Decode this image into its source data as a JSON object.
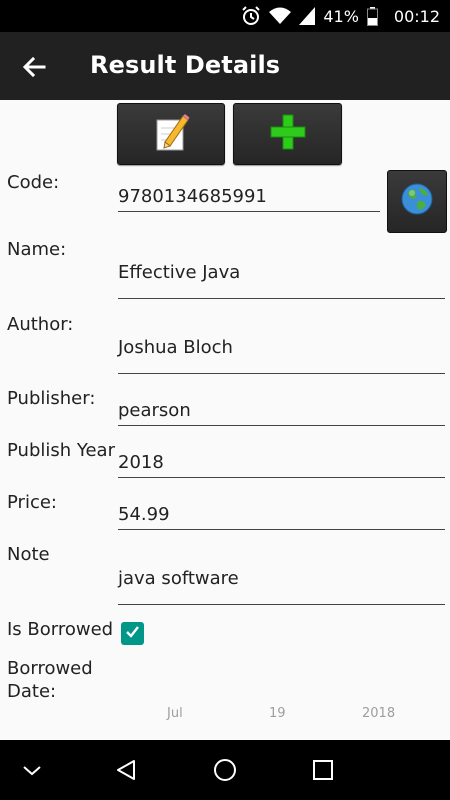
{
  "status_bar": {
    "battery": "41%",
    "time": "00:12",
    "icons": [
      "alarm-icon",
      "wifi-icon",
      "signal-icon",
      "battery-icon"
    ]
  },
  "app_bar": {
    "title": "Result Details",
    "back_icon": "arrow-left-icon"
  },
  "toolbar": {
    "edit_icon": "pencil-paper-icon",
    "add_icon": "green-plus-icon"
  },
  "form": {
    "code": {
      "label": "Code:",
      "value": "9780134685991"
    },
    "name": {
      "label": "Name:",
      "value": "Effective Java"
    },
    "author": {
      "label": "Author:",
      "value": "Joshua Bloch"
    },
    "publisher": {
      "label": "Publisher:",
      "value": "pearson"
    },
    "publish_year": {
      "label": "Publish Year",
      "value": "2018"
    },
    "price": {
      "label": "Price:",
      "value": "54.99"
    },
    "note": {
      "label": "Note",
      "value": "java software"
    },
    "is_borrowed": {
      "label": "Is Borrowed",
      "checked": true
    },
    "borrowed_date": {
      "label_line1": "Borrowed",
      "label_line2": "Date:",
      "month": "Jul",
      "day": "19",
      "year": "2018"
    },
    "lookup_icon": "globe-icon"
  },
  "colors": {
    "app_bar": "#212121",
    "checkbox": "#009688",
    "plus": "#2ecc1a"
  }
}
